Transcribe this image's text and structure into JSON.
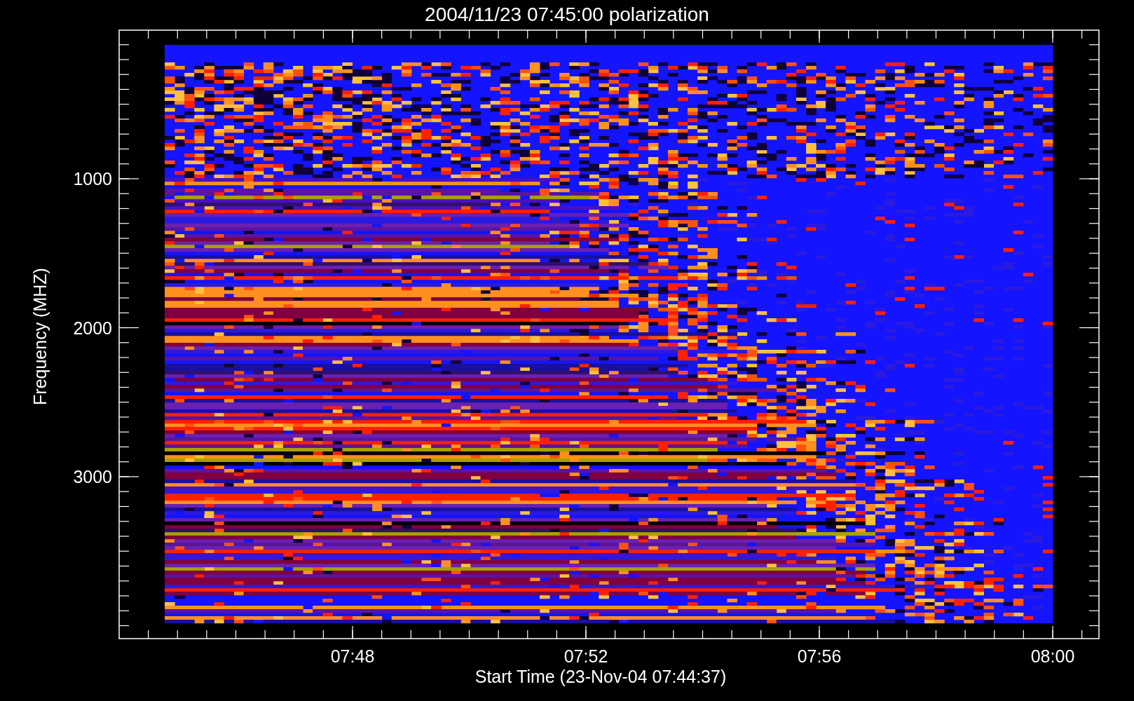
{
  "title": "2004/11/23 07:45:00 polarization",
  "plot": {
    "ylabel": "Frequency (MHZ)",
    "xlabel": "Start Time (23-Nov-04 07:44:37)",
    "yticks": [
      "1000",
      "2000",
      "3000"
    ],
    "xticks": [
      "07:48",
      "07:52",
      "07:56",
      "08:00"
    ]
  }
}
